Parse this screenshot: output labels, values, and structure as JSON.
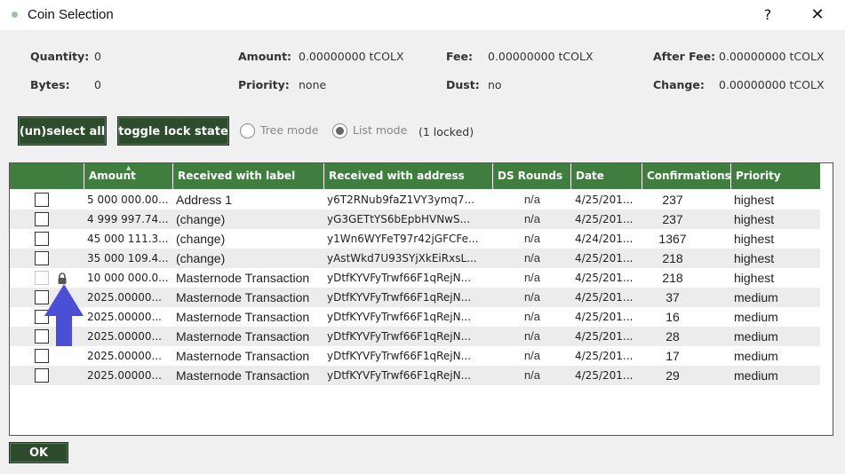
{
  "window": {
    "title": "Coin Selection",
    "help_glyph": "?",
    "close_glyph": "✕"
  },
  "summary": {
    "quantity_label": "Quantity:",
    "quantity_value": "0",
    "bytes_label": "Bytes:",
    "bytes_value": "0",
    "amount_label": "Amount:",
    "amount_value": "0.00000000 tCOLX",
    "priority_label": "Priority:",
    "priority_value": "none",
    "fee_label": "Fee:",
    "fee_value": "0.00000000 tCOLX",
    "dust_label": "Dust:",
    "dust_value": "no",
    "after_fee_label": "After Fee:",
    "after_fee_value": "0.00000000 tCOLX",
    "change_label": "Change:",
    "change_value": "0.00000000 tCOLX"
  },
  "controls": {
    "select_all_label": "(un)select all",
    "toggle_lock_label": "toggle lock state",
    "tree_mode_label": "Tree mode",
    "list_mode_label": "List mode",
    "selected_mode": "list",
    "locked_text": "(1 locked)"
  },
  "table": {
    "columns": [
      "Amount",
      "Received with label",
      "Received with address",
      "DS Rounds",
      "Date",
      "Confirmations",
      "Priority"
    ],
    "rows": [
      {
        "amount": "5 000 000.00...",
        "label": "Address 1",
        "address": "y6T2RNub9faZ1VY3ymq7...",
        "ds": "n/a",
        "date": "4/25/201...",
        "conf": "237",
        "priority": "highest",
        "checked": false,
        "locked": false
      },
      {
        "amount": "4 999 997.74...",
        "label": "(change)",
        "address": "yG3GETtYS6bEpbHVNwS...",
        "ds": "n/a",
        "date": "4/25/201...",
        "conf": "237",
        "priority": "highest",
        "checked": false,
        "locked": false
      },
      {
        "amount": "45 000 111.3...",
        "label": "(change)",
        "address": "y1Wn6WYFeT97r42jGFCFe...",
        "ds": "n/a",
        "date": "4/24/201...",
        "conf": "1367",
        "priority": "highest",
        "checked": false,
        "locked": false
      },
      {
        "amount": "35 000 109.4...",
        "label": "(change)",
        "address": "yAstWkd7U93SYjXkEiRxsL...",
        "ds": "n/a",
        "date": "4/25/201...",
        "conf": "218",
        "priority": "highest",
        "checked": false,
        "locked": false
      },
      {
        "amount": "10 000 000.0...",
        "label": "Masternode Transaction",
        "address": "yDtfKYVFyTrwf66F1qRejN...",
        "ds": "n/a",
        "date": "4/25/201...",
        "conf": "218",
        "priority": "highest",
        "checked": false,
        "locked": true
      },
      {
        "amount": "2025.00000...",
        "label": "Masternode Transaction",
        "address": "yDtfKYVFyTrwf66F1qRejN...",
        "ds": "n/a",
        "date": "4/25/201...",
        "conf": "37",
        "priority": "medium",
        "checked": false,
        "locked": false
      },
      {
        "amount": "2025.00000...",
        "label": "Masternode Transaction",
        "address": "yDtfKYVFyTrwf66F1qRejN...",
        "ds": "n/a",
        "date": "4/25/201...",
        "conf": "16",
        "priority": "medium",
        "checked": false,
        "locked": false
      },
      {
        "amount": "2025.00000...",
        "label": "Masternode Transaction",
        "address": "yDtfKYVFyTrwf66F1qRejN...",
        "ds": "n/a",
        "date": "4/25/201...",
        "conf": "28",
        "priority": "medium",
        "checked": false,
        "locked": false
      },
      {
        "amount": "2025.00000...",
        "label": "Masternode Transaction",
        "address": "yDtfKYVFyTrwf66F1qRejN...",
        "ds": "n/a",
        "date": "4/25/201...",
        "conf": "17",
        "priority": "medium",
        "checked": false,
        "locked": false
      },
      {
        "amount": "2025.00000...",
        "label": "Masternode Transaction",
        "address": "yDtfKYVFyTrwf66F1qRejN...",
        "ds": "n/a",
        "date": "4/25/201...",
        "conf": "29",
        "priority": "medium",
        "checked": false,
        "locked": false
      }
    ]
  },
  "footer": {
    "ok_label": "OK"
  },
  "colors": {
    "header_green": "#3f7e3f",
    "button_green": "#2d4b2d",
    "arrow_blue": "#4a4fd6"
  },
  "icons": {
    "lock": "lock-icon",
    "annotation": "up-arrow-icon"
  }
}
